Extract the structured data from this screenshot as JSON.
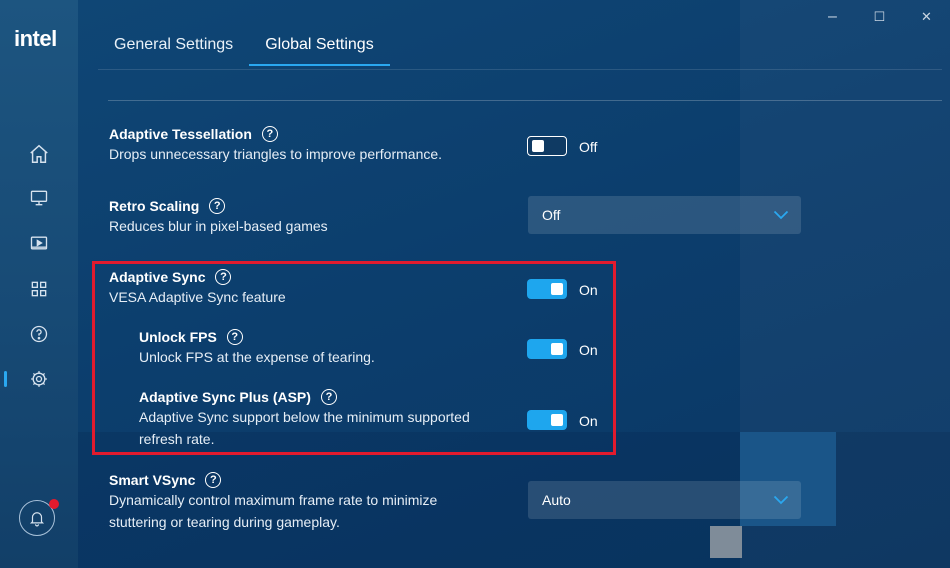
{
  "app": {
    "logo_text": "intel"
  },
  "sidebar": {
    "items": [
      {
        "name": "home",
        "icon": "home-icon"
      },
      {
        "name": "display",
        "icon": "monitor-icon"
      },
      {
        "name": "video",
        "icon": "video-icon"
      },
      {
        "name": "apps",
        "icon": "grid-icon"
      },
      {
        "name": "help",
        "icon": "help-icon"
      },
      {
        "name": "settings",
        "icon": "gear-icon",
        "active": true
      }
    ],
    "notification": {
      "icon": "bell-icon",
      "has_alert": true
    }
  },
  "window_controls": {
    "minimize": "–",
    "maximize": "☐",
    "close": "✕"
  },
  "tabs": [
    {
      "label": "General Settings",
      "active": false
    },
    {
      "label": "Global Settings",
      "active": true
    }
  ],
  "settings": {
    "adaptive_tessellation": {
      "title": "Adaptive Tessellation",
      "desc": "Drops unnecessary triangles to improve performance.",
      "state": "Off"
    },
    "retro_scaling": {
      "title": "Retro Scaling",
      "desc": "Reduces blur in pixel-based games",
      "value": "Off"
    },
    "adaptive_sync": {
      "title": "Adaptive Sync",
      "desc": "VESA Adaptive Sync feature",
      "state": "On"
    },
    "unlock_fps": {
      "title": "Unlock FPS",
      "desc": "Unlock FPS at the expense of tearing.",
      "state": "On"
    },
    "adaptive_sync_plus": {
      "title": "Adaptive Sync Plus (ASP)",
      "desc_line1": "Adaptive Sync support below the minimum supported",
      "desc_line2": "refresh rate.",
      "state": "On"
    },
    "smart_vsync": {
      "title": "Smart VSync",
      "desc_line1": "Dynamically control maximum frame rate to minimize",
      "desc_line2": "stuttering or tearing during gameplay.",
      "value": "Auto"
    }
  },
  "help_glyph": "?",
  "colors": {
    "accent": "#1ea6ee",
    "highlight": "#e21b2e",
    "alert": "#e21b2e"
  }
}
